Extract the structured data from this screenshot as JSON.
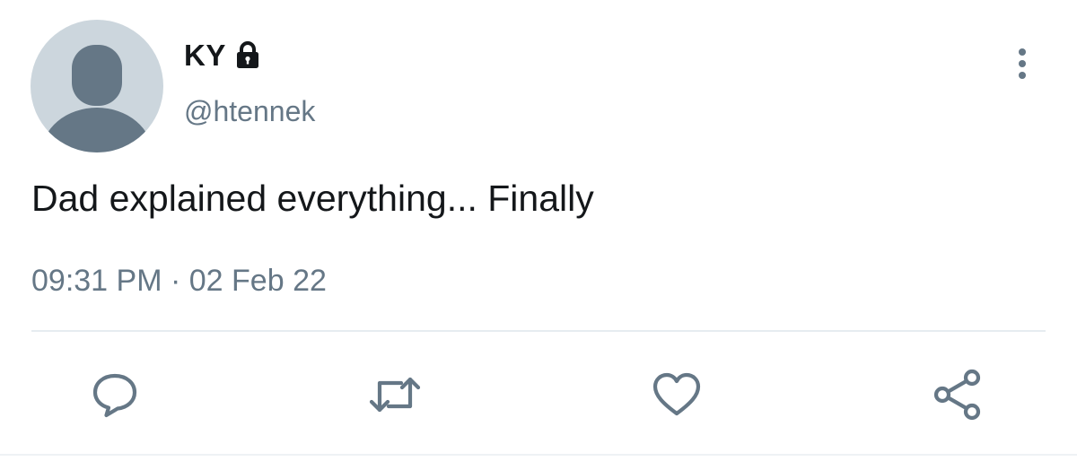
{
  "tweet": {
    "display_name": "KY",
    "handle": "@htennek",
    "text": "Dad explained everything... Finally",
    "time": "09:31 PM",
    "separator": "·",
    "date": "02 Feb 22",
    "protected": true
  },
  "icons": {
    "avatar": "default-avatar",
    "lock": "lock-icon",
    "more": "more-vertical-icon",
    "reply": "reply-icon",
    "retweet": "retweet-icon",
    "like": "heart-icon",
    "share": "share-icon"
  },
  "colors": {
    "text_primary": "#14171a",
    "text_secondary": "#657786",
    "avatar_bg": "#ccd6dd",
    "avatar_fg": "#657786",
    "divider": "#e6ecf0"
  }
}
